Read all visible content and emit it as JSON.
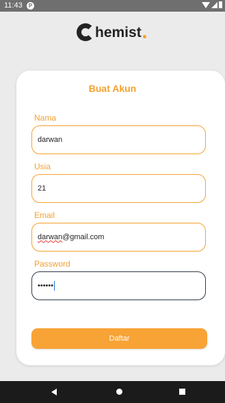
{
  "status_bar": {
    "time": "11:43",
    "notification_icon": "P"
  },
  "logo": {
    "text": "hemist"
  },
  "form": {
    "title": "Buat Akun",
    "name_label": "Nama",
    "name_value": "darwan",
    "age_label": "Usia",
    "age_value": "21",
    "email_label": "Email",
    "email_user": "darwan",
    "email_domain": "@gmail.com",
    "password_label": "Password",
    "password_value": "••••••",
    "submit_label": "Daftar"
  },
  "colors": {
    "accent": "#f5a02e",
    "card": "#ffffff",
    "background": "#ebebeb"
  },
  "icons": [
    "wifi-icon",
    "signal-icon",
    "battery-icon",
    "back-icon",
    "home-icon",
    "recent-apps-icon"
  ]
}
